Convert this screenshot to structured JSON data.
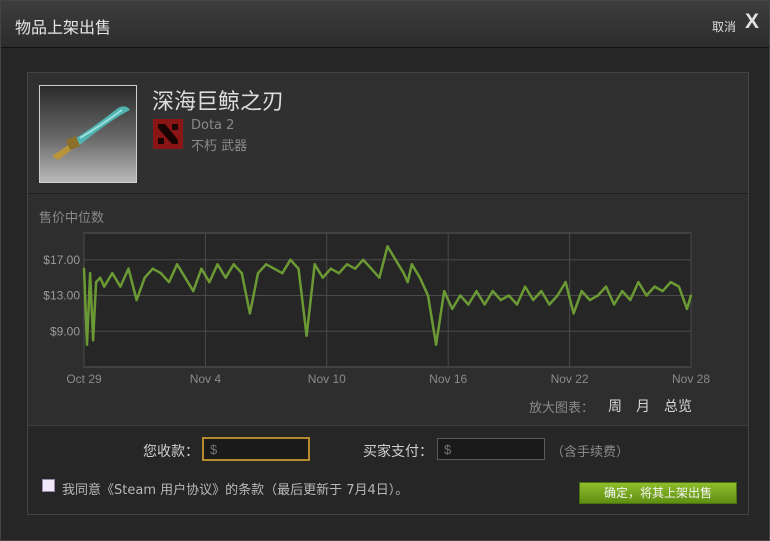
{
  "dialog": {
    "title": "物品上架出售",
    "cancel_label": "取消",
    "close_label": "X"
  },
  "item": {
    "name": "深海巨鲸之刃",
    "game": "Dota 2",
    "type": "不朽 武器"
  },
  "chart_label": "售价中位数",
  "chart_data": {
    "type": "line",
    "title": "",
    "xlabel": "",
    "ylabel": "",
    "x_ticks": [
      "Oct 29",
      "Nov 4",
      "Nov 10",
      "Nov 16",
      "Nov 22",
      "Nov 28"
    ],
    "y_ticks": [
      "$9.00",
      "$13.00",
      "$17.00"
    ],
    "xlim_days": [
      0,
      30
    ],
    "ylim": [
      5,
      20
    ],
    "grid": true,
    "line_color": "#6b9a35",
    "series": [
      {
        "name": "",
        "x_days": [
          0.0,
          0.15,
          0.3,
          0.45,
          0.6,
          0.8,
          1.0,
          1.4,
          1.8,
          2.2,
          2.6,
          3.0,
          3.4,
          3.8,
          4.2,
          4.6,
          5.0,
          5.4,
          5.8,
          6.2,
          6.6,
          7.0,
          7.4,
          7.8,
          8.2,
          8.6,
          9.0,
          9.4,
          9.8,
          10.2,
          10.6,
          11.0,
          11.4,
          11.8,
          12.2,
          12.6,
          13.0,
          13.4,
          13.8,
          14.2,
          14.6,
          15.0,
          15.4,
          15.8,
          16.0,
          16.2,
          16.6,
          17.0,
          17.4,
          17.8,
          18.2,
          18.6,
          19.0,
          19.4,
          19.8,
          20.2,
          20.6,
          21.0,
          21.4,
          21.8,
          22.2,
          22.6,
          23.0,
          23.4,
          23.8,
          24.2,
          24.6,
          25.0,
          25.4,
          25.8,
          26.2,
          26.6,
          27.0,
          27.4,
          27.8,
          28.2,
          28.6,
          29.0,
          29.4,
          29.8,
          30.0
        ],
        "values": [
          16.0,
          7.5,
          15.5,
          8.0,
          14.5,
          15.0,
          14.0,
          15.5,
          14.0,
          16.0,
          12.5,
          15.0,
          16.0,
          15.5,
          14.5,
          16.5,
          15.0,
          13.5,
          16.0,
          14.5,
          16.5,
          15.0,
          16.5,
          15.5,
          11.0,
          15.5,
          16.5,
          16.0,
          15.5,
          17.0,
          16.0,
          8.5,
          16.5,
          15.0,
          16.0,
          15.5,
          16.5,
          16.0,
          17.0,
          16.0,
          15.0,
          18.5,
          17.0,
          15.5,
          14.5,
          16.5,
          15.0,
          13.0,
          7.5,
          13.5,
          11.5,
          13.0,
          12.0,
          13.5,
          12.0,
          13.5,
          12.5,
          13.0,
          12.0,
          14.0,
          12.5,
          13.5,
          12.0,
          13.0,
          14.5,
          11.0,
          13.5,
          12.5,
          13.0,
          14.0,
          12.0,
          13.5,
          12.5,
          14.5,
          13.0,
          14.0,
          13.5,
          14.5,
          14.0,
          11.5,
          13.0
        ]
      }
    ]
  },
  "zoom": {
    "label": "放大图表：",
    "week": "周",
    "month": "月",
    "all": "总览"
  },
  "form": {
    "receive_label": "您收款：",
    "receive_placeholder": "$",
    "pay_label": "买家支付：",
    "pay_placeholder": "$",
    "fee_note": "（含手续费）",
    "agree_text": "我同意《Steam 用户协议》的条款（最后更新于 7月4日）。",
    "confirm_label": "确定，将其上架出售"
  },
  "colors": {
    "accent_green": "#6b9a35",
    "input_focus_border": "#b58a2f",
    "dota_red": "#8a1515"
  }
}
